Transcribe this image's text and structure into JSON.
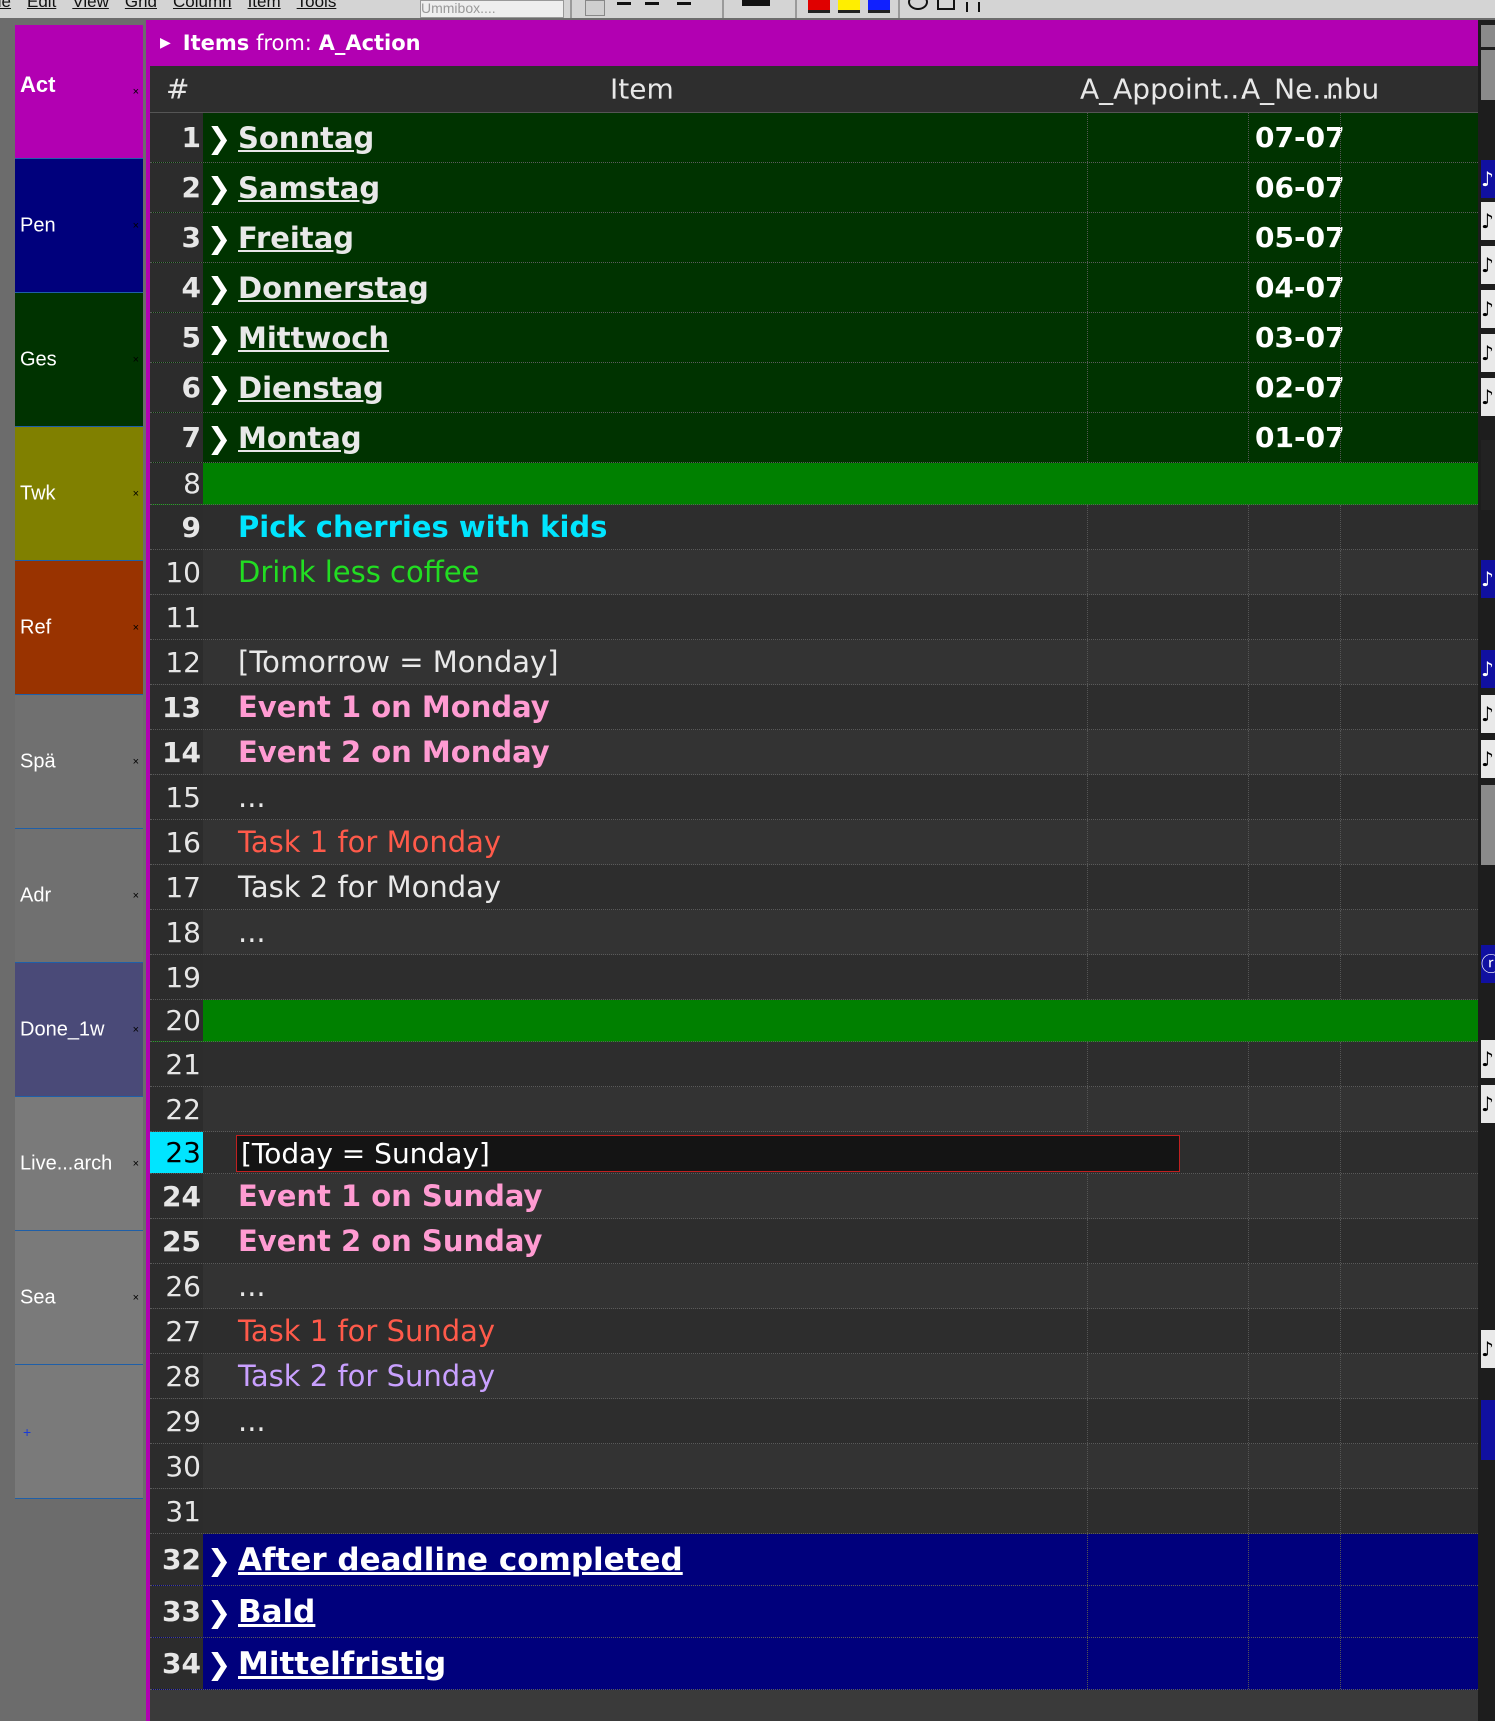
{
  "menu": {
    "items": [
      "ile",
      "Edit",
      "View",
      "Grid",
      "Column",
      "Item",
      "Tools"
    ],
    "combo_value": "Ummibox...."
  },
  "tabs": [
    {
      "label": "Act",
      "close": "×",
      "color": "#b200b2",
      "active": true
    },
    {
      "label": "Pen",
      "close": "×",
      "color": "#00007c"
    },
    {
      "label": "Ges",
      "close": "×",
      "color": "#003300"
    },
    {
      "label": "Twk",
      "close": "×",
      "color": "#808000"
    },
    {
      "label": "Ref",
      "close": "×",
      "color": "#993300"
    },
    {
      "label": "Spä",
      "close": "×",
      "color": "#707070"
    },
    {
      "label": "Adr",
      "close": "×",
      "color": "#707070"
    },
    {
      "label": "Done_1w",
      "close": "×",
      "color": "#4a4a78"
    },
    {
      "label": "Live...arch",
      "close": "×",
      "color": "#7a7a7a"
    },
    {
      "label": "Sea",
      "close": "×",
      "color": "#7a7a7a"
    },
    {
      "label": "+",
      "close": "",
      "color": "#7a7a7a"
    }
  ],
  "panel": {
    "title_lead": "Items",
    "title_mid": " from: ",
    "title_source": "A_Action",
    "accent": "#b200b2"
  },
  "columns": {
    "num": "#",
    "item": "Item",
    "appoint": "A_Appoint...",
    "ne": "A_Ne...",
    "nbu": "nbu"
  },
  "rows": [
    {
      "n": "1",
      "type": "day",
      "text": "Sonntag",
      "ne": "07-07"
    },
    {
      "n": "2",
      "type": "day",
      "text": "Samstag",
      "ne": "06-07"
    },
    {
      "n": "3",
      "type": "day",
      "text": "Freitag",
      "ne": "05-07"
    },
    {
      "n": "4",
      "type": "day",
      "text": "Donnerstag",
      "ne": "04-07"
    },
    {
      "n": "5",
      "type": "day",
      "text": "Mittwoch",
      "ne": "03-07"
    },
    {
      "n": "6",
      "type": "day",
      "text": "Dienstag",
      "ne": "02-07"
    },
    {
      "n": "7",
      "type": "day",
      "text": "Montag",
      "ne": "01-07"
    },
    {
      "n": "8",
      "type": "sep",
      "text": ""
    },
    {
      "n": "9",
      "type": "norm",
      "text": "Pick cherries with kids",
      "color": "#00e5ff",
      "bold": true
    },
    {
      "n": "10",
      "type": "norm",
      "text": "Drink less coffee",
      "color": "#22dd22"
    },
    {
      "n": "11",
      "type": "norm",
      "text": ""
    },
    {
      "n": "12",
      "type": "norm",
      "text": "[Tomorrow = Monday]",
      "color": "#e8e8e8"
    },
    {
      "n": "13",
      "type": "norm",
      "text": "Event 1 on Monday",
      "color": "#ff9bd2",
      "bold": true
    },
    {
      "n": "14",
      "type": "norm",
      "text": "Event 2 on Monday",
      "color": "#ff9bd2",
      "bold": true
    },
    {
      "n": "15",
      "type": "norm",
      "text": "...",
      "color": "#e8e8e8"
    },
    {
      "n": "16",
      "type": "norm",
      "text": "Task 1 for Monday",
      "color": "#ff5a4a"
    },
    {
      "n": "17",
      "type": "norm",
      "text": "Task 2 for Monday",
      "color": "#e8e8e8"
    },
    {
      "n": "18",
      "type": "norm",
      "text": "...",
      "color": "#e8e8e8"
    },
    {
      "n": "19",
      "type": "norm",
      "text": ""
    },
    {
      "n": "20",
      "type": "sep",
      "text": ""
    },
    {
      "n": "21",
      "type": "norm",
      "text": ""
    },
    {
      "n": "22",
      "type": "norm",
      "text": ""
    },
    {
      "n": "23",
      "type": "edit",
      "text": "[Today = Sunday]",
      "selected": true
    },
    {
      "n": "24",
      "type": "norm",
      "text": "Event 1 on Sunday",
      "color": "#ff9bd2",
      "bold": true
    },
    {
      "n": "25",
      "type": "norm",
      "text": "Event 2 on Sunday",
      "color": "#ff9bd2",
      "bold": true
    },
    {
      "n": "26",
      "type": "norm",
      "text": "...",
      "color": "#e8e8e8"
    },
    {
      "n": "27",
      "type": "norm",
      "text": "Task 1 for Sunday",
      "color": "#ff5a4a"
    },
    {
      "n": "28",
      "type": "norm",
      "text": "Task 2 for Sunday",
      "color": "#c9a0ff"
    },
    {
      "n": "29",
      "type": "norm",
      "text": "...",
      "color": "#e8e8e8"
    },
    {
      "n": "30",
      "type": "norm",
      "text": ""
    },
    {
      "n": "31",
      "type": "norm",
      "text": ""
    },
    {
      "n": "32",
      "type": "bucket",
      "text": "After deadline completed"
    },
    {
      "n": "33",
      "type": "bucket",
      "text": "Bald"
    },
    {
      "n": "34",
      "type": "bucket",
      "text": "Mittelfristig"
    }
  ],
  "expand_glyph": "❯",
  "flag_glyph": "▶"
}
